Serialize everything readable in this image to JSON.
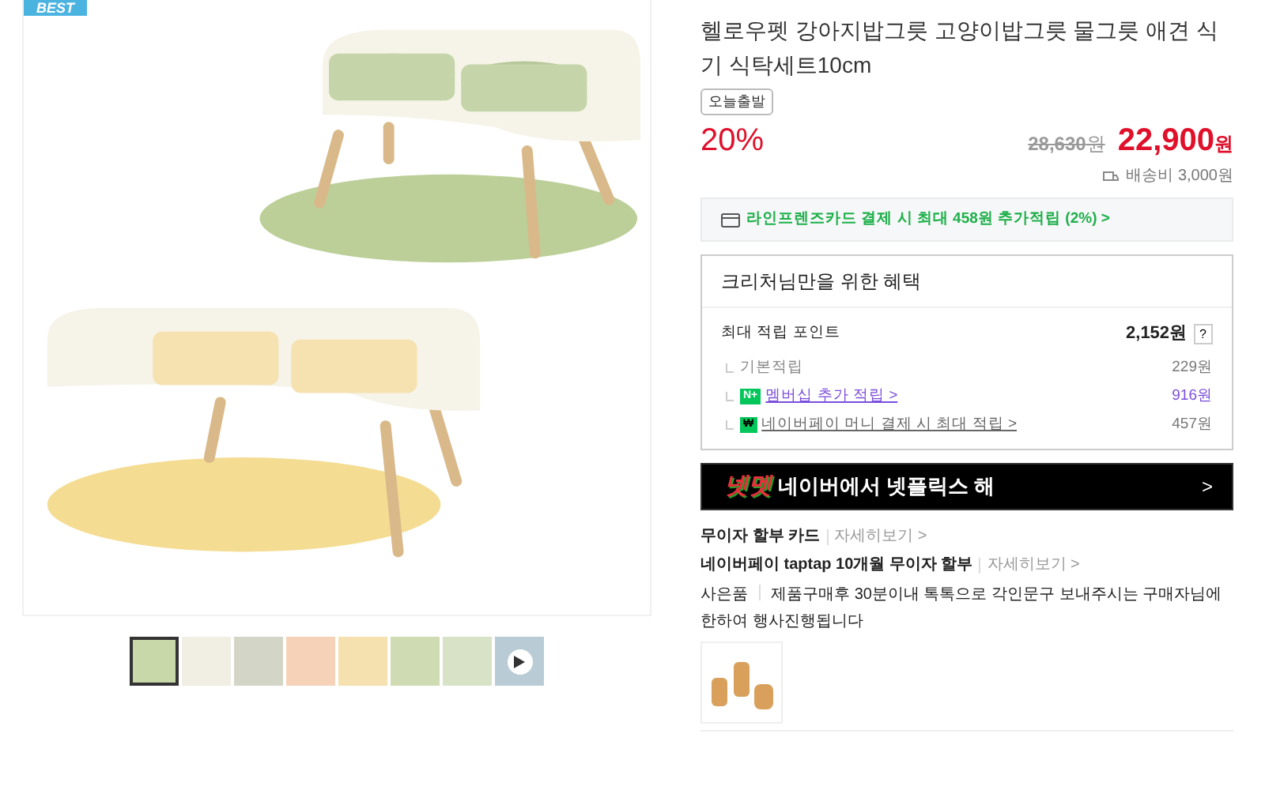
{
  "badge": "BEST",
  "thumbnails": [
    {
      "kind": "image",
      "selected": true,
      "color": "#c9d8a8"
    },
    {
      "kind": "image",
      "selected": false,
      "color": "#f1eee4"
    },
    {
      "kind": "image",
      "selected": false,
      "color": "#d3d6c6"
    },
    {
      "kind": "image",
      "selected": false,
      "color": "#f6d2b8"
    },
    {
      "kind": "image",
      "selected": false,
      "color": "#f5e1b0"
    },
    {
      "kind": "image",
      "selected": false,
      "color": "#cfdcb3"
    },
    {
      "kind": "image",
      "selected": false,
      "color": "#d8e2c6"
    },
    {
      "kind": "video",
      "selected": false,
      "color": "#b9ccd6"
    }
  ],
  "product": {
    "title": "헬로우펫 강아지밥그릇 고양이밥그릇 물그릇 애견 식기 식탁세트10cm",
    "tag": "오늘출발",
    "discount": "20%",
    "original_price": "28,630",
    "original_unit": "원",
    "price": "22,900",
    "price_unit": "원",
    "shipping": "배송비 3,000원"
  },
  "card_promo": {
    "text": "라인프렌즈카드 결제 시 최대 458원 추가적립 (2%)",
    "arrow": ">"
  },
  "benefits": {
    "title": "크리처님만을 위한 혜택",
    "total_label": "최대 적립 포인트",
    "total_value": "2,152원",
    "help": "?",
    "rows": [
      {
        "kind": "base",
        "label": "기본적립",
        "value": "229원"
      },
      {
        "kind": "membership",
        "badge": "N+",
        "label": "멤버십 추가 적립",
        "arrow": ">",
        "value": "916원"
      },
      {
        "kind": "money",
        "badge": "₩",
        "label": "네이버페이 머니 결제 시 최대 적립",
        "arrow": ">",
        "value": "457원"
      }
    ]
  },
  "banner": {
    "logo": "넷멧",
    "text": "네이버에서 넷플릭스 해",
    "arrow": ">"
  },
  "installments": [
    {
      "label": "무이자 할부 카드",
      "link": "자세히보기 >"
    },
    {
      "label": "네이버페이 taptap 10개월 무이자 할부",
      "link": "자세히보기 >"
    }
  ],
  "gift": {
    "label": "사은품",
    "text": "제품구매후 30분이내 톡톡으로 각인문구 보내주시는 구매자님에 한하여 행사진행됩니다"
  }
}
